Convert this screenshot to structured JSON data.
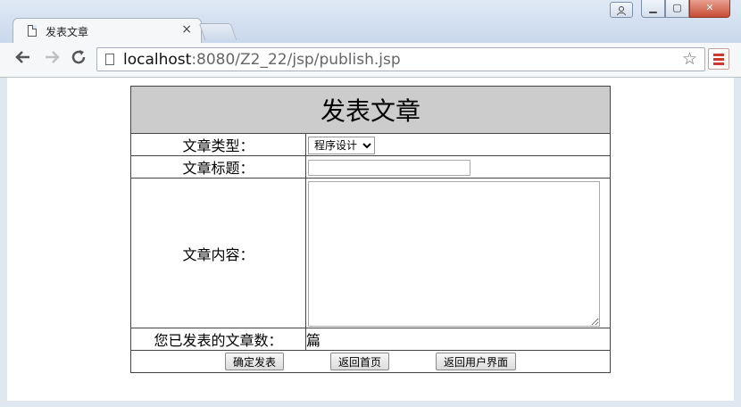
{
  "tab": {
    "title": "发表文章",
    "close": "×"
  },
  "window": {
    "user_icon": "user-icon",
    "min": "▁",
    "max": "▢",
    "close": "✕"
  },
  "address": {
    "host": "localhost",
    "path": ":8080/Z2_22/jsp/publish.jsp"
  },
  "form": {
    "heading": "发表文章",
    "type_label": "文章类型：",
    "type_selected": "程序设计",
    "title_label": "文章标题：",
    "title_value": "",
    "content_label": "文章内容：",
    "content_value": "",
    "count_label": "您已发表的文章数：",
    "count_value": "篇",
    "submit_label": "确定发表",
    "home_label": "返回首页",
    "user_label": "返回用户界面"
  },
  "colors": {
    "header_bg": "#cccccc",
    "border": "#444444",
    "menu_accent": "#d2362c"
  }
}
